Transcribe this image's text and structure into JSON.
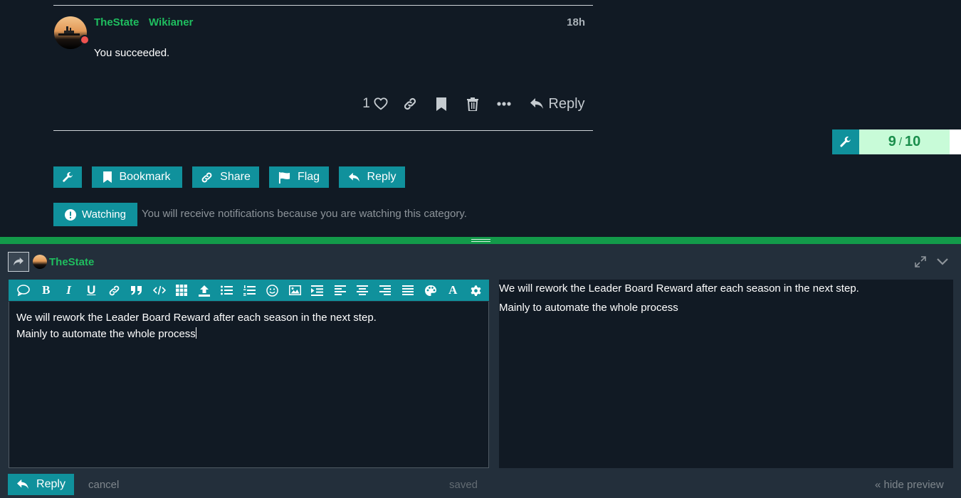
{
  "post": {
    "username": "TheState",
    "user_title": "Wikianer",
    "time": "18h",
    "body": "You succeeded.",
    "like_count": "1",
    "reply_label": "Reply"
  },
  "progress": {
    "current": "9",
    "separator": "/",
    "total": "10"
  },
  "topic_footer": {
    "bookmark": "Bookmark",
    "share": "Share",
    "flag": "Flag",
    "reply": "Reply"
  },
  "notifications": {
    "level": "Watching",
    "reason": "You will receive notifications because you are watching this category."
  },
  "composer": {
    "username": "TheState",
    "text_line1": "We will rework the Leader Board Reward after each season in the next step.",
    "text_line2": "Mainly to automate the whole process",
    "preview_line1": "We will rework the Leader Board Reward after each season in the next step.",
    "preview_line2": "Mainly to automate the whole process",
    "reply_label": "Reply",
    "cancel_label": "cancel",
    "saved_label": "saved",
    "hide_preview_label": "« hide preview",
    "toolbar_bold": "B",
    "toolbar_italic": "I",
    "toolbar_underline": "U",
    "toolbar_font": "A"
  },
  "colors": {
    "accent": "#10919c",
    "username": "#1fbe5f",
    "background": "#111a24",
    "composer_bg": "#232f3b",
    "progress_fill": "#c8fbd8"
  }
}
